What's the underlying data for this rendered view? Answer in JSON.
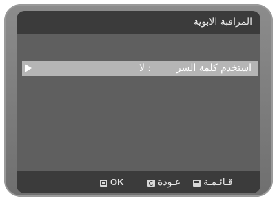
{
  "header": {
    "title": "المراقبة الابوية"
  },
  "menu": {
    "items": [
      {
        "label": "استخدم كلمة السر",
        "value": ": لا"
      }
    ]
  },
  "footer": {
    "menu_label": "قـائـمـة",
    "back_label": "عـودة",
    "ok_label": "OK"
  },
  "colors": {
    "screen_bg": "#5f5f5f",
    "bar_bg": "#3b3b3b",
    "highlight": "#b5b5b5",
    "bezel": "#7a7a7a"
  },
  "icons": [
    "arrow-right-icon",
    "menu-icon",
    "back-icon",
    "ok-icon"
  ]
}
